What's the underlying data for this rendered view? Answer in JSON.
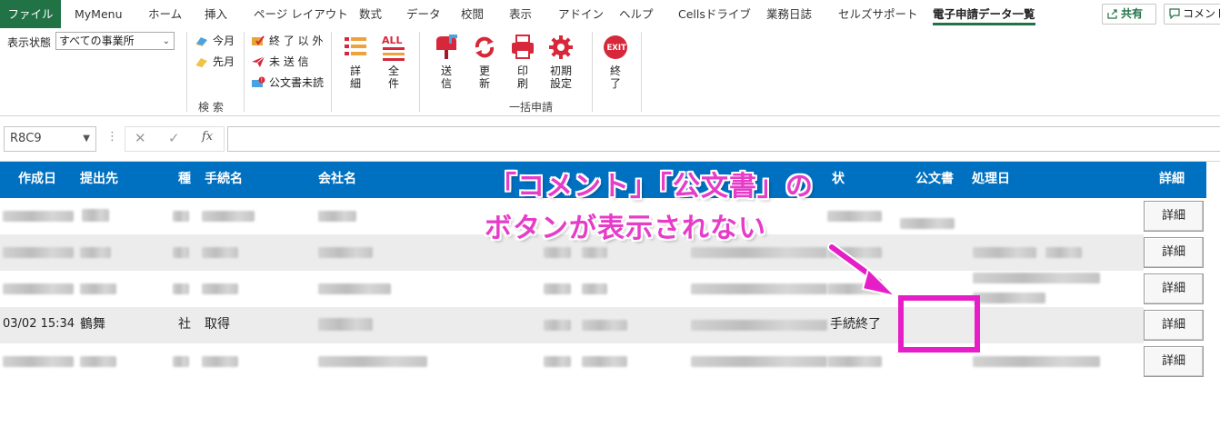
{
  "tabs": [
    "ファイル",
    "MyMenu",
    "ホーム",
    "挿入",
    "ページ レイアウト",
    "数式",
    "データ",
    "校閲",
    "表示",
    "アドイン",
    "ヘルプ",
    "Cellsドライブ",
    "業務日誌",
    "セルズサポート",
    "電子申請データ一覧"
  ],
  "share": {
    "share_label": "共有",
    "comment_label": "コメント"
  },
  "ribbon": {
    "display_state_label": "表示状態",
    "office_select_value": "すべての事業所",
    "this_month": "今月",
    "last_month": "先月",
    "completed": "終 了 以 外",
    "unsent": "未 送 信",
    "unread_docs": "公文書未読",
    "detail_btn": "詳細",
    "all_btn": "全件",
    "all_icon_text": "ALL",
    "search_group": "検 索",
    "send_btn": "送信",
    "update_btn": "更新",
    "print_btn": "印刷",
    "init_btn": "初期設定",
    "bulk_group": "一括申請",
    "exit_btn": "終了",
    "exit_icon_text": "EXIT"
  },
  "formula": {
    "name_box": "R8C9",
    "fx": "fx"
  },
  "headers": {
    "created": "作成日",
    "dest": "提出先",
    "kind": "種",
    "proc": "手続名",
    "company": "会社名",
    "status": "状",
    "docs": "公文書",
    "processed": "処理日",
    "detail": "詳細"
  },
  "row4": {
    "created": "03/02 15:34",
    "dest": "鶴舞",
    "kind": "社",
    "proc": "取得",
    "status": "手続終了"
  },
  "detail_label": "詳細",
  "annotation": {
    "line1": "「コメント」「公文書」の",
    "line2": "ボタンが表示されない"
  },
  "colors": {
    "excel_green": "#217346",
    "header_blue": "#0071c1",
    "annotation_magenta": "#e63cc8"
  }
}
